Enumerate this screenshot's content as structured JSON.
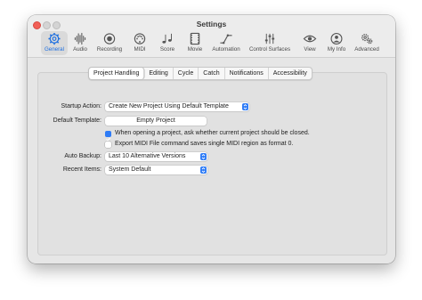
{
  "window": {
    "title": "Settings"
  },
  "toolbar": {
    "items": [
      {
        "label": "General",
        "icon": "gear-icon",
        "active": true
      },
      {
        "label": "Audio",
        "icon": "waveform-icon"
      },
      {
        "label": "Recording",
        "icon": "record-icon"
      },
      {
        "label": "MIDI",
        "icon": "midi-port-icon"
      },
      {
        "label": "Score",
        "icon": "music-notes-icon"
      },
      {
        "label": "Movie",
        "icon": "film-icon"
      },
      {
        "label": "Automation",
        "icon": "automation-curve-icon"
      },
      {
        "label": "Control Surfaces",
        "icon": "faders-icon"
      },
      {
        "label": "View",
        "icon": "eye-icon"
      },
      {
        "label": "My Info",
        "icon": "person-icon"
      },
      {
        "label": "Advanced",
        "icon": "gears-icon"
      }
    ],
    "accent": "#1e6fe0"
  },
  "tabs": {
    "items": [
      "Project Handling",
      "Editing",
      "Cycle",
      "Catch",
      "Notifications",
      "Accessibility"
    ],
    "selected": "Project Handling"
  },
  "form": {
    "startup_label": "Startup Action:",
    "startup_value": "Create New Project Using Default Template",
    "template_label": "Default Template:",
    "template_button": "Empty Project",
    "check_close": {
      "label": "When opening a project, ask whether current project should be closed.",
      "checked": true
    },
    "check_export": {
      "label": "Export MIDI File command saves single MIDI region as format 0.",
      "checked": false
    },
    "backup_label": "Auto Backup:",
    "backup_value": "Last 10 Alternative Versions",
    "recent_label": "Recent Items:",
    "recent_value": "System Default"
  }
}
